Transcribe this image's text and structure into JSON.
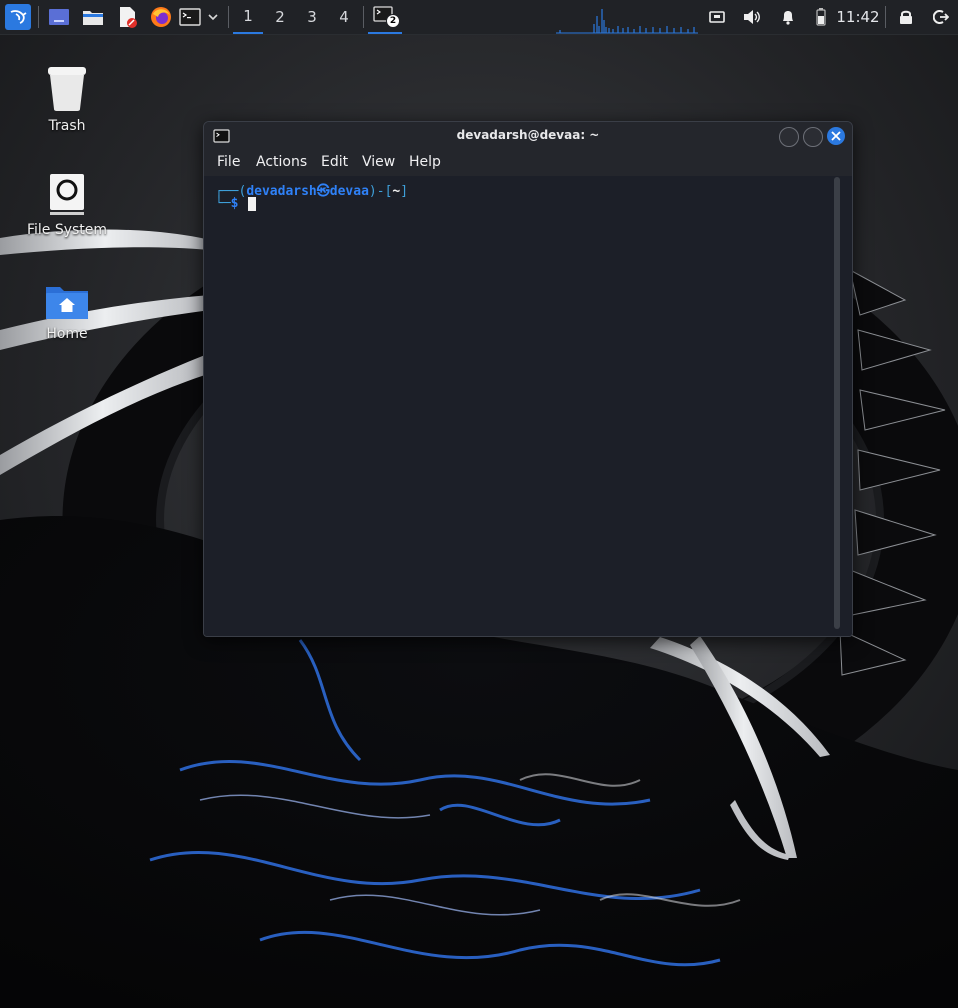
{
  "panel": {
    "workspaces": [
      "1",
      "2",
      "3",
      "4"
    ],
    "active_workspace": "1",
    "terminal_task_badge": "2",
    "clock": "11:42"
  },
  "desktop": {
    "icons": [
      {
        "label": "Trash"
      },
      {
        "label": "File System"
      },
      {
        "label": "Home"
      }
    ]
  },
  "terminal": {
    "title": "devadarsh@devaa: ~",
    "menu": [
      "File",
      "Actions",
      "Edit",
      "View",
      "Help"
    ],
    "prompt": {
      "corner_top": "┌──",
      "open_paren": "(",
      "user": "devadarsh",
      "at_symbol": "㉿",
      "host": "devaa",
      "close_paren": ")-[",
      "path": "~",
      "close_bracket": "]",
      "corner_bottom": "└─",
      "symbol": "$"
    }
  },
  "colors": {
    "accent": "#2b79e0",
    "prompt_blue": "#2f81f7",
    "prompt_cyan": "#3e9fd9",
    "terminal_bg": "#1c1f28",
    "panel_bg": "#202226"
  }
}
